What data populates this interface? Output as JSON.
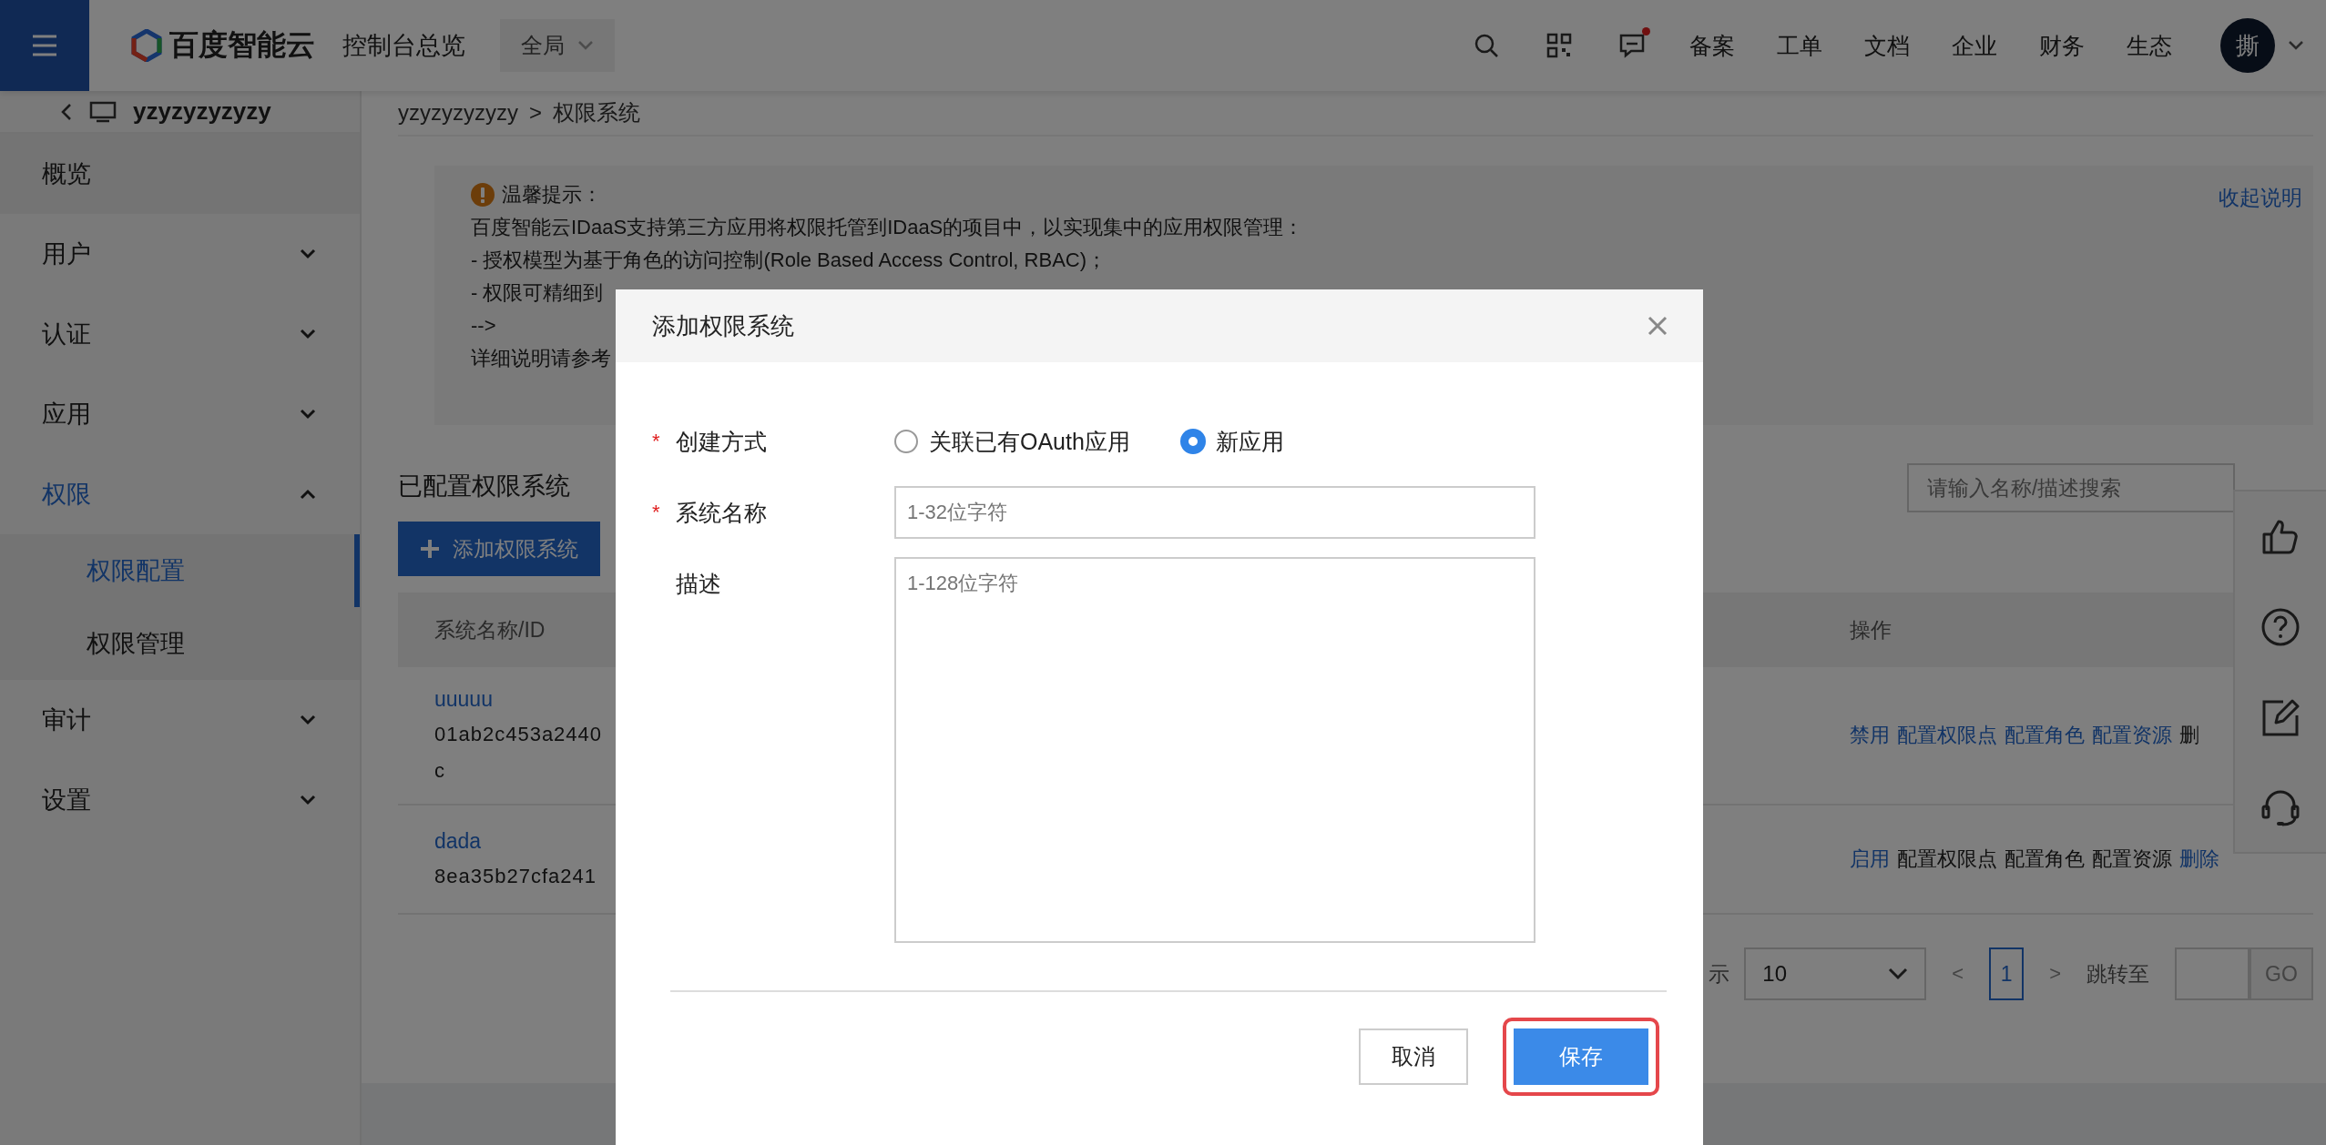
{
  "header": {
    "brand": "百度智能云",
    "console": "控制台总览",
    "region": "全局",
    "nav": [
      "备案",
      "工单",
      "文档",
      "企业",
      "财务",
      "生态"
    ],
    "message_badge": true,
    "avatar": "撕"
  },
  "sidebar": {
    "back_label": "yzyzyzyzyzy",
    "items": [
      {
        "label": "概览",
        "kind": "link",
        "selected": false
      },
      {
        "label": "用户",
        "kind": "group",
        "selected": false,
        "expanded": false
      },
      {
        "label": "认证",
        "kind": "group",
        "selected": false,
        "expanded": false
      },
      {
        "label": "应用",
        "kind": "group",
        "selected": false,
        "expanded": false
      },
      {
        "label": "权限",
        "kind": "group",
        "selected": true,
        "expanded": true,
        "children": [
          {
            "label": "权限配置",
            "selected": true
          },
          {
            "label": "权限管理",
            "selected": false
          }
        ]
      },
      {
        "label": "审计",
        "kind": "group",
        "selected": false,
        "expanded": false
      },
      {
        "label": "设置",
        "kind": "group",
        "selected": false,
        "expanded": false
      }
    ]
  },
  "breadcrumb": {
    "items": [
      "yzyzyzyzyzy",
      "权限系统"
    ],
    "separator": ">"
  },
  "notice": {
    "title": "温馨提示：",
    "collapse_link": "收起说明",
    "lines": [
      "百度智能云IDaaS支持第三方应用将权限托管到IDaaS的项目中，以实现集中的应用权限管理：",
      "- 授权模型为基于角色的访问控制(Role Based Access Control, RBAC)；",
      "- 权限可精细到",
      "-->",
      "详细说明请参考"
    ]
  },
  "section_title": "已配置权限系统",
  "add_button": "添加权限系统",
  "search": {
    "placeholder": "请输入名称/描述搜索"
  },
  "table": {
    "columns": [
      "系统名称/ID",
      "操作"
    ],
    "rows": [
      {
        "name": "uuuuu",
        "id_lines": [
          "01ab2c453a2440",
          "c"
        ],
        "actions": [
          {
            "label": "禁用",
            "enabled": true
          },
          {
            "label": "配置权限点",
            "enabled": true
          },
          {
            "label": "配置角色",
            "enabled": true
          },
          {
            "label": "配置资源",
            "enabled": true
          },
          {
            "label": "删",
            "enabled": false
          }
        ]
      },
      {
        "name": "dada",
        "id_lines": [
          "8ea35b27cfa241"
        ],
        "actions": [
          {
            "label": "启用",
            "enabled": true
          },
          {
            "label": "配置权限点",
            "enabled": false
          },
          {
            "label": "配置角色",
            "enabled": false
          },
          {
            "label": "配置资源",
            "enabled": false
          },
          {
            "label": "删除",
            "enabled": true
          }
        ]
      }
    ]
  },
  "pagination": {
    "page_size_label": "示",
    "page_size": "10",
    "prev": "<",
    "next": ">",
    "pages": [
      {
        "label": "1",
        "selected": true
      }
    ],
    "jump_label": "跳转至",
    "go": "GO"
  },
  "modal": {
    "title": "添加权限系统",
    "fields": [
      {
        "kind": "radio",
        "label": "创建方式",
        "required": true,
        "options": [
          {
            "label": "关联已有OAuth应用",
            "selected": false
          },
          {
            "label": "新应用",
            "selected": true
          }
        ]
      },
      {
        "kind": "input",
        "label": "系统名称",
        "required": true,
        "placeholder": "1-32位字符"
      },
      {
        "kind": "textarea",
        "label": "描述",
        "required": false,
        "placeholder": "1-128位字符"
      }
    ],
    "required_mark": "*",
    "cancel": "取消",
    "save": "保存",
    "save_highlighted": true
  }
}
